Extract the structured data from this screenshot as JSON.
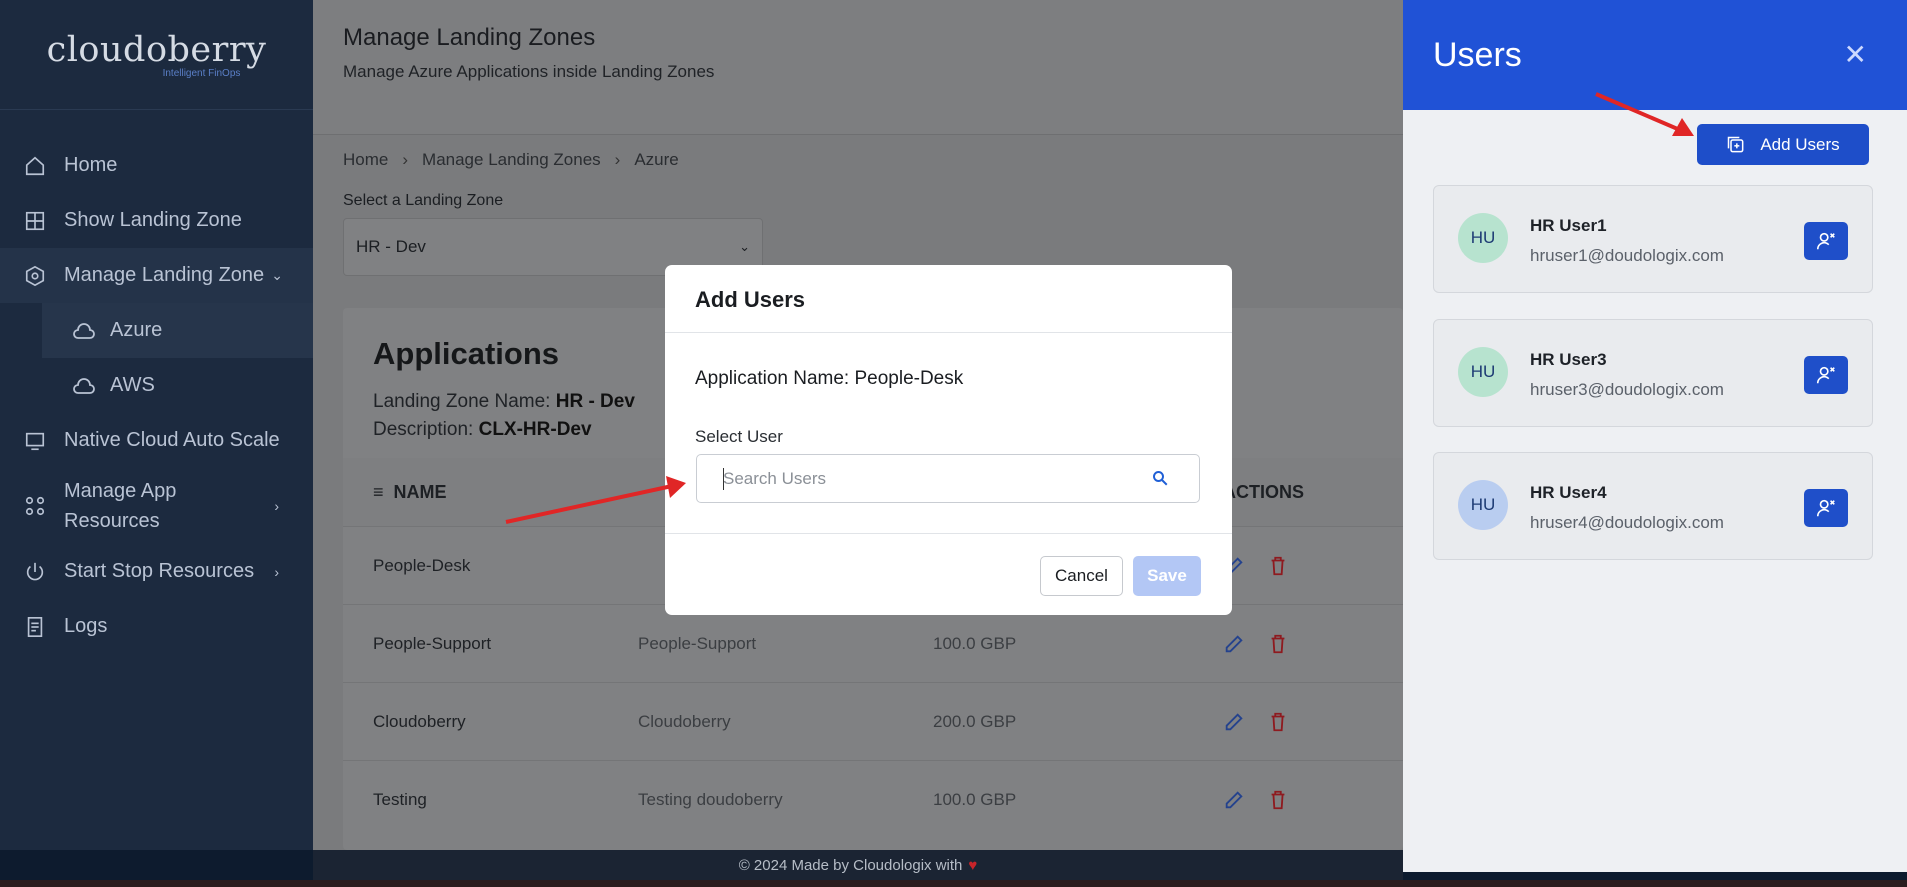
{
  "sidebar": {
    "brand": "cloudoberry",
    "tagline": "Intelligent FinOps",
    "items": [
      {
        "label": "Home"
      },
      {
        "label": "Show Landing Zone"
      },
      {
        "label": "Manage Landing Zone"
      },
      {
        "label": "Azure"
      },
      {
        "label": "AWS"
      },
      {
        "label": "Native Cloud Auto Scale"
      },
      {
        "label": "Manage App Resources"
      },
      {
        "label": "Start Stop Resources"
      },
      {
        "label": "Logs"
      }
    ]
  },
  "header": {
    "title": "Manage Landing Zones",
    "subtitle": "Manage Azure Applications inside Landing Zones"
  },
  "breadcrumb": [
    "Home",
    "Manage Landing Zones",
    "Azure"
  ],
  "landing_zone": {
    "label": "Select a Landing Zone",
    "selected": "HR - Dev"
  },
  "applications": {
    "title": "Applications",
    "zone_name_label": "Landing Zone Name:",
    "zone_name_value": "HR - Dev",
    "description_label": "Description:",
    "description_value": "CLX-HR-Dev",
    "columns": {
      "name": "NAME",
      "actions": "ACTIONS"
    },
    "rows": [
      {
        "name": "People-Desk",
        "description": "",
        "budget": ""
      },
      {
        "name": "People-Support",
        "description": "People-Support",
        "budget": "100.0 GBP"
      },
      {
        "name": "Cloudoberry",
        "description": "Cloudoberry",
        "budget": "200.0 GBP"
      },
      {
        "name": "Testing",
        "description": "Testing doudoberry",
        "budget": "100.0 GBP"
      }
    ]
  },
  "footer": {
    "text": "© 2024 Made by Cloudologix with"
  },
  "users_panel": {
    "title": "Users",
    "close": "✕",
    "add_label": "Add Users",
    "users": [
      {
        "initials": "HU",
        "name": "HR User1",
        "email": "hruser1@doudologix.com",
        "avatar_color": "#b7e3cf"
      },
      {
        "initials": "HU",
        "name": "HR User3",
        "email": "hruser3@doudologix.com",
        "avatar_color": "#b7e3cf"
      },
      {
        "initials": "HU",
        "name": "HR User4",
        "email": "hruser4@doudologix.com",
        "avatar_color": "#b9cdf0"
      }
    ]
  },
  "modal": {
    "title": "Add Users",
    "app_label": "Application Name: People-Desk",
    "select_label": "Select User",
    "search_placeholder": "Search Users",
    "cancel_label": "Cancel",
    "save_label": "Save"
  },
  "colors": {
    "accent": "#2052d6",
    "sidebar": "#1c2a3f",
    "danger": "#c8242a"
  }
}
